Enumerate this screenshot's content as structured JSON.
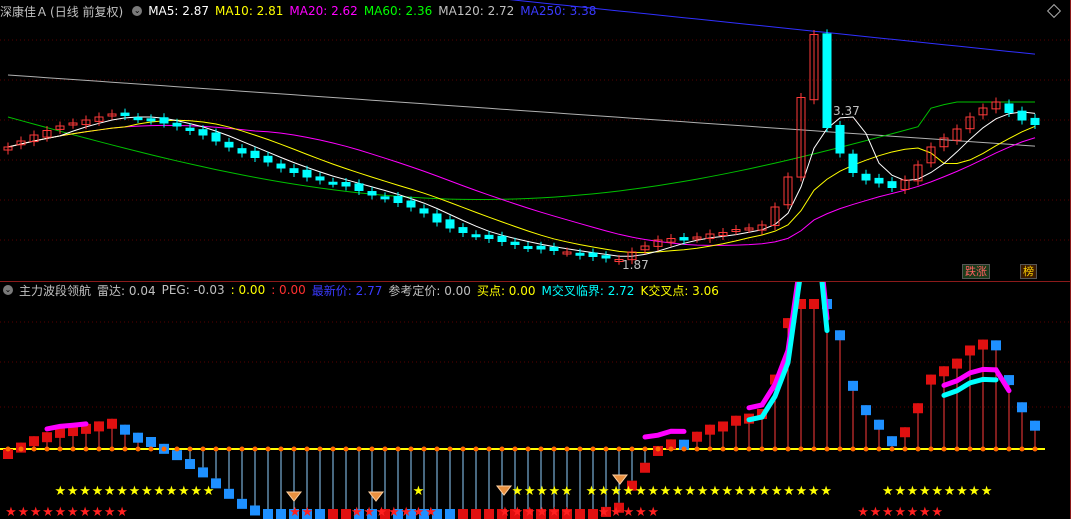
{
  "top": {
    "title": "深康佳Ａ",
    "period": "(日线 前复权)",
    "ma": [
      {
        "label": "MA5: 2.87",
        "color": "#ffffff"
      },
      {
        "label": "MA10: 2.81",
        "color": "#ffff00"
      },
      {
        "label": "MA20: 2.62",
        "color": "#ff00ff"
      },
      {
        "label": "MA60: 2.36",
        "color": "#00ff00"
      },
      {
        "label": "MA120: 2.72",
        "color": "#c0c0c0"
      },
      {
        "label": "MA250: 3.38",
        "color": "#3a3aff"
      }
    ],
    "high_label": "3.37",
    "low_label": "1.87",
    "tag_limit": "跌涨",
    "tag_rank": "榜"
  },
  "bottom": {
    "title": "主力波段领航",
    "items": [
      {
        "label": "雷达: 0.04",
        "color": "#c0c0c0"
      },
      {
        "label": "PEG: -0.03",
        "color": "#c0c0c0"
      },
      {
        "label": ": 0.00",
        "color": "#ffff00"
      },
      {
        "label": ": 0.00",
        "color": "#ff3030"
      },
      {
        "label": "最新价: 2.77",
        "color": "#3a3aff"
      },
      {
        "label": "参考定价: 0.00",
        "color": "#c0c0c0"
      },
      {
        "label": "买点: 0.00",
        "color": "#ffff00"
      },
      {
        "label": "M交叉临界: 2.72",
        "color": "#00ffff"
      },
      {
        "label": "K交叉点: 3.06",
        "color": "#ffff00"
      }
    ]
  },
  "colors": {
    "up": "#ff3a3a",
    "down": "#00ffff",
    "ma5": "#ffffff",
    "ma10": "#ffff00",
    "ma20": "#ff00ff",
    "ma60": "#00c000",
    "ma120": "#b0b0b0",
    "ma250": "#3030ff"
  },
  "chart_data": {
    "type": "candlestick",
    "high": 3.37,
    "low": 1.87,
    "closes": [
      2.62,
      2.66,
      2.7,
      2.73,
      2.76,
      2.78,
      2.8,
      2.82,
      2.84,
      2.83,
      2.81,
      2.8,
      2.78,
      2.76,
      2.73,
      2.7,
      2.66,
      2.62,
      2.58,
      2.55,
      2.52,
      2.48,
      2.45,
      2.42,
      2.4,
      2.38,
      2.36,
      2.33,
      2.3,
      2.28,
      2.25,
      2.22,
      2.18,
      2.12,
      2.08,
      2.05,
      2.03,
      2.01,
      1.99,
      1.97,
      1.95,
      1.94,
      1.93,
      1.92,
      1.9,
      1.89,
      1.88,
      1.87,
      1.92,
      1.96,
      2.0,
      2.01,
      2.0,
      2.02,
      2.04,
      2.05,
      2.07,
      2.08,
      2.1,
      2.22,
      2.42,
      2.95,
      3.37,
      2.75,
      2.58,
      2.45,
      2.4,
      2.38,
      2.35,
      2.4,
      2.5,
      2.62,
      2.68,
      2.74,
      2.82,
      2.88,
      2.92,
      2.85,
      2.8,
      2.77
    ]
  }
}
